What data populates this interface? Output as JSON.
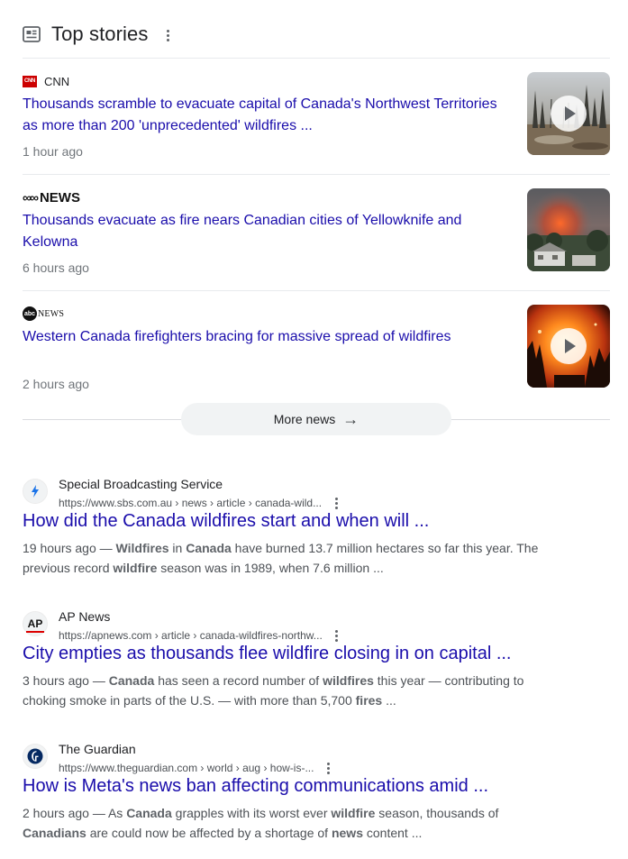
{
  "header": {
    "title": "Top stories",
    "icon": "newspaper-icon"
  },
  "stories": [
    {
      "source": "CNN",
      "logo": "CNN",
      "headline": "Thousands scramble to evacuate capital of Canada's Northwest Territories as more than 200 'unprecedented' wildfires ...",
      "time": "1 hour ago",
      "has_video": true
    },
    {
      "source": "NEWS",
      "logo": "ABC",
      "headline": "Thousands evacuate as fire nears Canadian cities of Yellowknife and Kelowna",
      "time": "6 hours ago",
      "has_video": false
    },
    {
      "source": "NEWS",
      "logo": "abc",
      "headline": "Western Canada firefighters bracing for massive spread of wildfires",
      "time": "2 hours ago",
      "has_video": true
    }
  ],
  "more_news": {
    "label": "More news",
    "arrow": "→"
  },
  "results": [
    {
      "site_name": "Special Broadcasting Service",
      "url": "https://www.sbs.com.au › news › article › canada-wild...",
      "title": "How did the Canada wildfires start and when will ...",
      "snippet_parts": [
        {
          "t": "19 hours ago — ",
          "b": false
        },
        {
          "t": "Wildfires",
          "b": true
        },
        {
          "t": " in ",
          "b": false
        },
        {
          "t": "Canada",
          "b": true
        },
        {
          "t": " have burned 13.7 million hectares so far this year. The previous record ",
          "b": false
        },
        {
          "t": "wildfire",
          "b": true
        },
        {
          "t": " season was in 1989, when 7.6 million ...",
          "b": false
        }
      ]
    },
    {
      "site_name": "AP News",
      "logo": "AP",
      "url": "https://apnews.com › article › canada-wildfires-northw...",
      "title": "City empties as thousands flee wildfire closing in on capital ...",
      "snippet_parts": [
        {
          "t": "3 hours ago — ",
          "b": false
        },
        {
          "t": "Canada",
          "b": true
        },
        {
          "t": " has seen a record number of ",
          "b": false
        },
        {
          "t": "wildfires",
          "b": true
        },
        {
          "t": " this year — contributing to choking smoke in parts of the U.S. — with more than 5,700 ",
          "b": false
        },
        {
          "t": "fires",
          "b": true
        },
        {
          "t": " ...",
          "b": false
        }
      ]
    },
    {
      "site_name": "The Guardian",
      "url": "https://www.theguardian.com › world › aug › how-is-...",
      "title": "How is Meta's news ban affecting communications amid ...",
      "snippet_parts": [
        {
          "t": "2 hours ago — As ",
          "b": false
        },
        {
          "t": "Canada",
          "b": true
        },
        {
          "t": " grapples with its worst ever ",
          "b": false
        },
        {
          "t": "wildfire",
          "b": true
        },
        {
          "t": " season, thousands of ",
          "b": false
        },
        {
          "t": "Canadians",
          "b": true
        },
        {
          "t": " are could now be affected by a shortage of ",
          "b": false
        },
        {
          "t": "news",
          "b": true
        },
        {
          "t": " content ...",
          "b": false
        }
      ]
    }
  ]
}
